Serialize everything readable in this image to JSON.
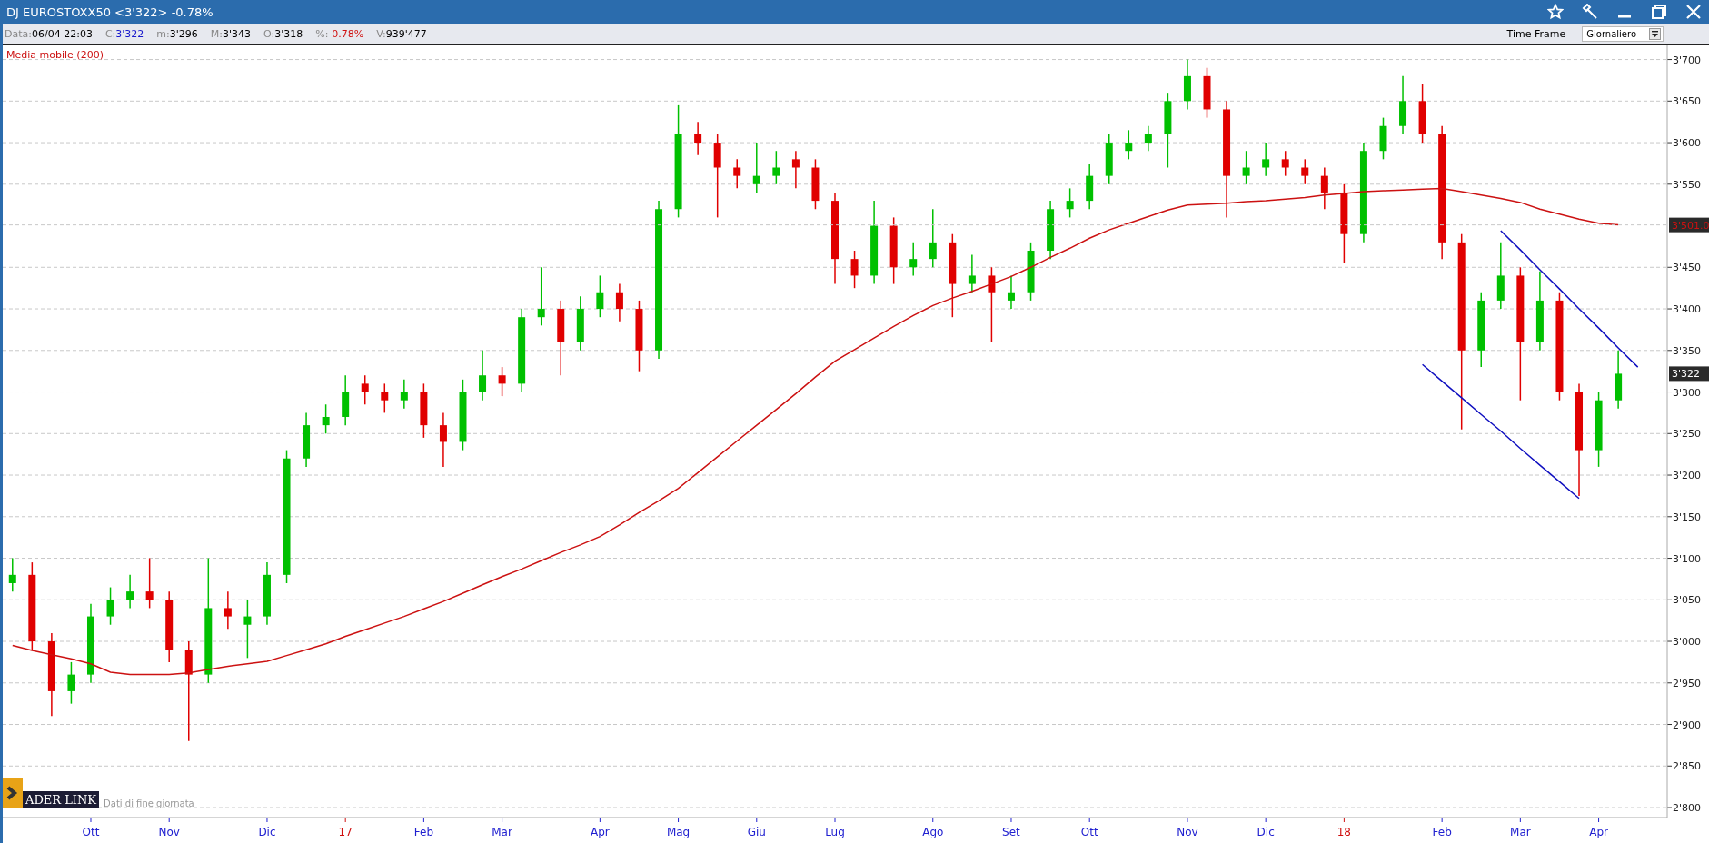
{
  "window": {
    "title": "DJ EUROSTOXX50 <3'322> -0.78%"
  },
  "info_bar": [
    {
      "label": "Data:",
      "value": "06/04 22:03",
      "color": "#000000"
    },
    {
      "label": "C:",
      "value": "3'322",
      "color": "#1a1acc"
    },
    {
      "label": "m:",
      "value": "3'296",
      "color": "#000000"
    },
    {
      "label": "M:",
      "value": "3'343",
      "color": "#000000"
    },
    {
      "label": "O:",
      "value": "3'318",
      "color": "#000000"
    },
    {
      "label": "%:",
      "value": "-0.78%",
      "color": "#d01010"
    },
    {
      "label": "V:",
      "value": "939'477",
      "color": "#000000"
    }
  ],
  "time_frame": {
    "label": "Time Frame",
    "value": "Giornaliero"
  },
  "chart": {
    "chart_data": {
      "type": "candlestick",
      "grid": true,
      "ylim": [
        2788,
        3717
      ],
      "categories": [
        null,
        null,
        null,
        null,
        "Ott",
        null,
        null,
        null,
        "Nov",
        null,
        null,
        null,
        null,
        "Dic",
        null,
        null,
        null,
        "17",
        null,
        null,
        null,
        "Feb",
        null,
        null,
        null,
        "Mar",
        null,
        null,
        null,
        null,
        "Apr",
        null,
        null,
        null,
        "Mag",
        null,
        null,
        null,
        "Giu",
        null,
        null,
        null,
        "Lug",
        null,
        null,
        null,
        null,
        "Ago",
        null,
        null,
        null,
        "Set",
        null,
        null,
        null,
        "Ott",
        null,
        null,
        null,
        null,
        "Nov",
        null,
        null,
        null,
        "Dic",
        null,
        null,
        null,
        "18",
        null,
        null,
        null,
        null,
        "Feb",
        null,
        null,
        null,
        "Mar",
        null,
        null,
        null,
        "Apr",
        null,
        null,
        null
      ],
      "ohlc": [
        [
          3070,
          3100,
          3060,
          3080
        ],
        [
          3080,
          3095,
          2990,
          3000
        ],
        [
          3000,
          3010,
          2910,
          2940
        ],
        [
          2940,
          2975,
          2925,
          2960
        ],
        [
          2960,
          3045,
          2950,
          3030
        ],
        [
          3030,
          3065,
          3020,
          3050
        ],
        [
          3050,
          3080,
          3040,
          3060
        ],
        [
          3060,
          3100,
          3040,
          3050
        ],
        [
          3050,
          3060,
          2975,
          2990
        ],
        [
          2990,
          3000,
          2880,
          2960
        ],
        [
          2960,
          3100,
          2950,
          3040
        ],
        [
          3040,
          3060,
          3015,
          3030
        ],
        [
          3020,
          3050,
          2980,
          3030
        ],
        [
          3030,
          3095,
          3020,
          3080
        ],
        [
          3080,
          3230,
          3070,
          3220
        ],
        [
          3220,
          3275,
          3210,
          3260
        ],
        [
          3260,
          3285,
          3250,
          3270
        ],
        [
          3270,
          3320,
          3260,
          3300
        ],
        [
          3310,
          3320,
          3285,
          3300
        ],
        [
          3300,
          3310,
          3275,
          3290
        ],
        [
          3290,
          3315,
          3280,
          3300
        ],
        [
          3300,
          3310,
          3245,
          3260
        ],
        [
          3260,
          3275,
          3210,
          3240
        ],
        [
          3240,
          3315,
          3230,
          3300
        ],
        [
          3300,
          3350,
          3290,
          3320
        ],
        [
          3320,
          3330,
          3295,
          3310
        ],
        [
          3310,
          3400,
          3300,
          3390
        ],
        [
          3390,
          3450,
          3380,
          3400
        ],
        [
          3400,
          3410,
          3320,
          3360
        ],
        [
          3360,
          3415,
          3350,
          3400
        ],
        [
          3400,
          3440,
          3390,
          3420
        ],
        [
          3420,
          3430,
          3385,
          3400
        ],
        [
          3400,
          3410,
          3325,
          3350
        ],
        [
          3350,
          3530,
          3340,
          3520
        ],
        [
          3520,
          3645,
          3510,
          3610
        ],
        [
          3610,
          3625,
          3585,
          3600
        ],
        [
          3600,
          3610,
          3510,
          3570
        ],
        [
          3570,
          3580,
          3545,
          3560
        ],
        [
          3550,
          3600,
          3540,
          3560
        ],
        [
          3560,
          3590,
          3550,
          3570
        ],
        [
          3580,
          3590,
          3545,
          3570
        ],
        [
          3570,
          3580,
          3520,
          3530
        ],
        [
          3530,
          3540,
          3430,
          3460
        ],
        [
          3460,
          3470,
          3425,
          3440
        ],
        [
          3440,
          3530,
          3430,
          3500
        ],
        [
          3500,
          3510,
          3430,
          3450
        ],
        [
          3450,
          3480,
          3440,
          3460
        ],
        [
          3460,
          3520,
          3450,
          3480
        ],
        [
          3480,
          3490,
          3390,
          3430
        ],
        [
          3430,
          3465,
          3420,
          3440
        ],
        [
          3440,
          3450,
          3360,
          3420
        ],
        [
          3410,
          3440,
          3400,
          3420
        ],
        [
          3420,
          3480,
          3410,
          3470
        ],
        [
          3470,
          3530,
          3460,
          3520
        ],
        [
          3520,
          3545,
          3510,
          3530
        ],
        [
          3530,
          3575,
          3520,
          3560
        ],
        [
          3560,
          3610,
          3550,
          3600
        ],
        [
          3590,
          3615,
          3580,
          3600
        ],
        [
          3600,
          3620,
          3590,
          3610
        ],
        [
          3610,
          3660,
          3570,
          3650
        ],
        [
          3650,
          3700,
          3640,
          3680
        ],
        [
          3680,
          3690,
          3630,
          3640
        ],
        [
          3640,
          3650,
          3510,
          3560
        ],
        [
          3560,
          3590,
          3550,
          3570
        ],
        [
          3570,
          3600,
          3560,
          3580
        ],
        [
          3580,
          3590,
          3560,
          3570
        ],
        [
          3570,
          3580,
          3550,
          3560
        ],
        [
          3560,
          3570,
          3520,
          3540
        ],
        [
          3540,
          3550,
          3455,
          3490
        ],
        [
          3490,
          3600,
          3480,
          3590
        ],
        [
          3590,
          3630,
          3580,
          3620
        ],
        [
          3620,
          3680,
          3610,
          3650
        ],
        [
          3650,
          3670,
          3600,
          3610
        ],
        [
          3610,
          3620,
          3460,
          3480
        ],
        [
          3480,
          3490,
          3255,
          3350
        ],
        [
          3350,
          3420,
          3330,
          3410
        ],
        [
          3410,
          3480,
          3400,
          3440
        ],
        [
          3440,
          3450,
          3290,
          3360
        ],
        [
          3360,
          3445,
          3350,
          3410
        ],
        [
          3410,
          3420,
          3290,
          3300
        ],
        [
          3300,
          3310,
          3175,
          3230
        ],
        [
          3230,
          3300,
          3210,
          3290
        ],
        [
          3290,
          3350,
          3280,
          3322
        ],
        null,
        null
      ],
      "series": [
        {
          "type": "line",
          "name": "Media mobile (200)",
          "color": "#cc1111",
          "values": [
            2995,
            2989,
            2984,
            2979,
            2973,
            2963,
            2960,
            2960,
            2960,
            2962,
            2966,
            2970,
            2973,
            2976,
            2983,
            2990,
            2997,
            3006,
            3014,
            3022,
            3030,
            3039,
            3048,
            3058,
            3068,
            3078,
            3087,
            3097,
            3107,
            3116,
            3126,
            3140,
            3155,
            3169,
            3184,
            3203,
            3222,
            3241,
            3260,
            3279,
            3298,
            3318,
            3337,
            3351,
            3365,
            3379,
            3392,
            3404,
            3413,
            3421,
            3430,
            3439,
            3450,
            3462,
            3473,
            3485,
            3495,
            3503,
            3511,
            3519,
            3525,
            3526,
            3527,
            3529,
            3530,
            3532,
            3534,
            3537,
            3539,
            3541,
            3542,
            3543,
            3544,
            3545,
            3541,
            3537,
            3533,
            3528,
            3520,
            3514,
            3508,
            3503,
            3501,
            null,
            null
          ]
        },
        {
          "type": "line",
          "color": "#1010c0",
          "values": [
            null,
            null,
            null,
            null,
            null,
            null,
            null,
            null,
            null,
            null,
            null,
            null,
            null,
            null,
            null,
            null,
            null,
            null,
            null,
            null,
            null,
            null,
            null,
            null,
            null,
            null,
            null,
            null,
            null,
            null,
            null,
            null,
            null,
            null,
            null,
            null,
            null,
            null,
            null,
            null,
            null,
            null,
            null,
            null,
            null,
            null,
            null,
            null,
            null,
            null,
            null,
            null,
            null,
            null,
            null,
            null,
            null,
            null,
            null,
            null,
            null,
            null,
            null,
            null,
            null,
            null,
            null,
            null,
            null,
            null,
            null,
            null,
            3333,
            3313,
            3293,
            3273,
            3253,
            3232,
            3212,
            3192,
            3172,
            null,
            null,
            null,
            null
          ]
        },
        {
          "type": "line",
          "color": "#1010c0",
          "values": [
            null,
            null,
            null,
            null,
            null,
            null,
            null,
            null,
            null,
            null,
            null,
            null,
            null,
            null,
            null,
            null,
            null,
            null,
            null,
            null,
            null,
            null,
            null,
            null,
            null,
            null,
            null,
            null,
            null,
            null,
            null,
            null,
            null,
            null,
            null,
            null,
            null,
            null,
            null,
            null,
            null,
            null,
            null,
            null,
            null,
            null,
            null,
            null,
            null,
            null,
            null,
            null,
            null,
            null,
            null,
            null,
            null,
            null,
            null,
            null,
            null,
            null,
            null,
            null,
            null,
            null,
            null,
            null,
            null,
            null,
            null,
            null,
            null,
            null,
            null,
            null,
            3494,
            3471,
            3447,
            3424,
            3400,
            3377,
            3353,
            3330,
            null
          ]
        }
      ],
      "yticks": [
        {
          "value": 2800,
          "label": "2'800"
        },
        {
          "value": 2850,
          "label": "2'850"
        },
        {
          "value": 2900,
          "label": "2'900"
        },
        {
          "value": 2950,
          "label": "2'950"
        },
        {
          "value": 3000,
          "label": "3'000"
        },
        {
          "value": 3050,
          "label": "3'050"
        },
        {
          "value": 3100,
          "label": "3'100"
        },
        {
          "value": 3150,
          "label": "3'150"
        },
        {
          "value": 3200,
          "label": "3'200"
        },
        {
          "value": 3250,
          "label": "3'250"
        },
        {
          "value": 3300,
          "label": "3'300"
        },
        {
          "value": 3350,
          "label": "3'350"
        },
        {
          "value": 3400,
          "label": "3'400"
        },
        {
          "value": 3450,
          "label": "3'450"
        },
        {
          "value": 3550,
          "label": "3'550"
        },
        {
          "value": 3600,
          "label": "3'600"
        },
        {
          "value": 3650,
          "label": "3'650"
        },
        {
          "value": 3700,
          "label": "3'700"
        }
      ]
    },
    "x_labels": [
      {
        "color": "#2020d0"
      },
      {
        "color": "#2020d0"
      },
      {
        "color": "#2020d0"
      },
      {
        "color": "#d01010"
      },
      {
        "color": "#2020d0"
      },
      {
        "color": "#2020d0"
      },
      {
        "color": "#2020d0"
      },
      {
        "color": "#2020d0"
      },
      {
        "color": "#2020d0"
      },
      {
        "color": "#2020d0"
      },
      {
        "color": "#2020d0"
      },
      {
        "color": "#2020d0"
      },
      {
        "color": "#2020d0"
      },
      {
        "color": "#2020d0"
      },
      {
        "color": "#2020d0"
      },
      {
        "color": "#d01010"
      },
      {
        "color": "#2020d0"
      },
      {
        "color": "#2020d0"
      },
      {
        "color": "#2020d0"
      }
    ],
    "price_labels": [
      {
        "label": "3'501.0"
      },
      {
        "label": "3'322"
      }
    ]
  },
  "logo": {
    "text": "ADER LINK",
    "caption": "Dati di fine giornata"
  }
}
